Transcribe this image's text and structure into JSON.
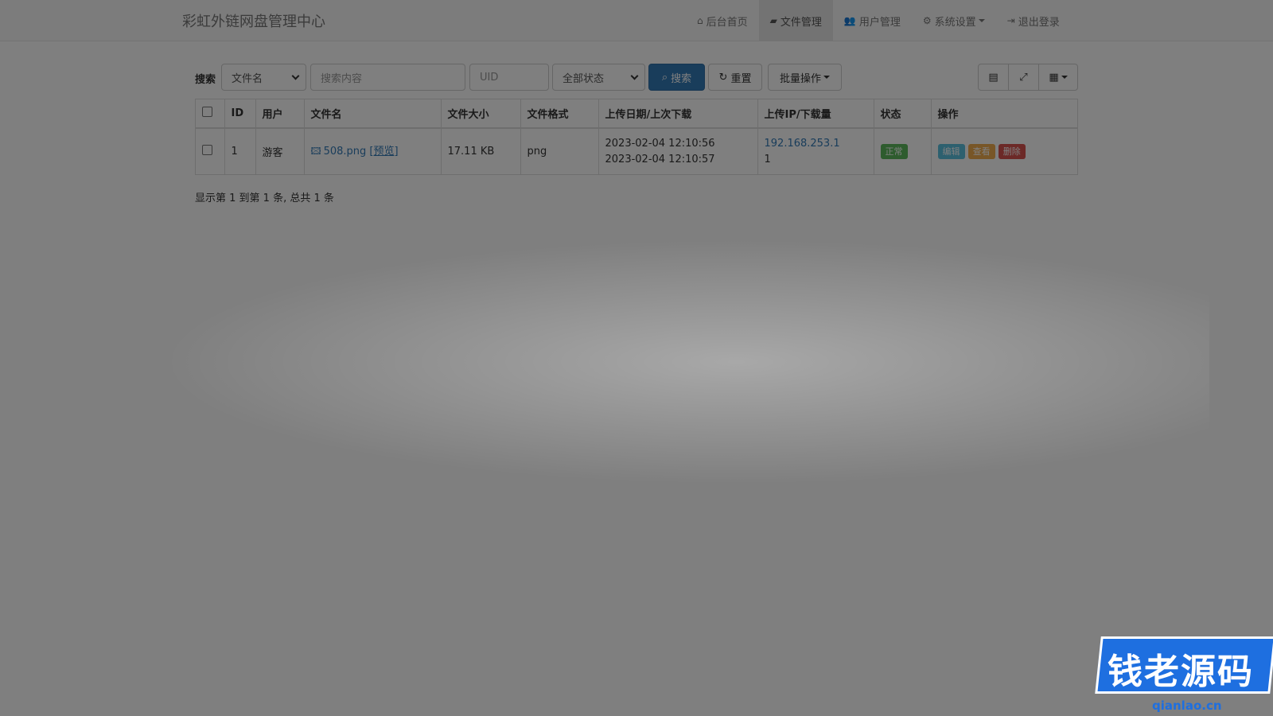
{
  "navbar": {
    "brand": "彩虹外链网盘管理中心",
    "items": [
      {
        "label": "后台首页",
        "icon": "home-icon",
        "active": false
      },
      {
        "label": "文件管理",
        "icon": "folder-open-icon",
        "active": true
      },
      {
        "label": "用户管理",
        "icon": "users-icon",
        "active": false
      },
      {
        "label": "系统设置",
        "icon": "gear-icon",
        "active": false,
        "dropdown": true
      },
      {
        "label": "退出登录",
        "icon": "logout-icon",
        "active": false
      }
    ]
  },
  "toolbar": {
    "search_label": "搜索",
    "field_select": "文件名",
    "keyword_placeholder": "搜索内容",
    "uid_placeholder": "UID",
    "status_select": "全部状态",
    "search_button": "搜索",
    "reset_button": "重置",
    "batch_button": "批量操作"
  },
  "table": {
    "columns": [
      "ID",
      "用户",
      "文件名",
      "文件大小",
      "文件格式",
      "上传日期/上次下载",
      "上传IP/下载量",
      "状态",
      "操作"
    ],
    "rows": [
      {
        "id": "1",
        "user": "游客",
        "filename": "508.png",
        "preview": "[预览]",
        "size": "17.11 KB",
        "format": "png",
        "upload_date": "2023-02-04 12:10:56",
        "last_download": "2023-02-04 12:10:57",
        "upload_ip": "192.168.253.1",
        "downloads": "1",
        "status": "正常",
        "actions": [
          "编辑",
          "查看",
          "删除"
        ]
      }
    ]
  },
  "summary": "显示第 1 到第 1 条, 总共 1 条",
  "watermark": {
    "text": "钱老源码",
    "url": "qianlao.cn"
  },
  "colors": {
    "primary": "#337ab7",
    "success": "#5cb85c",
    "info": "#5bc0de",
    "warning": "#f0ad4e",
    "danger": "#d9534f"
  }
}
